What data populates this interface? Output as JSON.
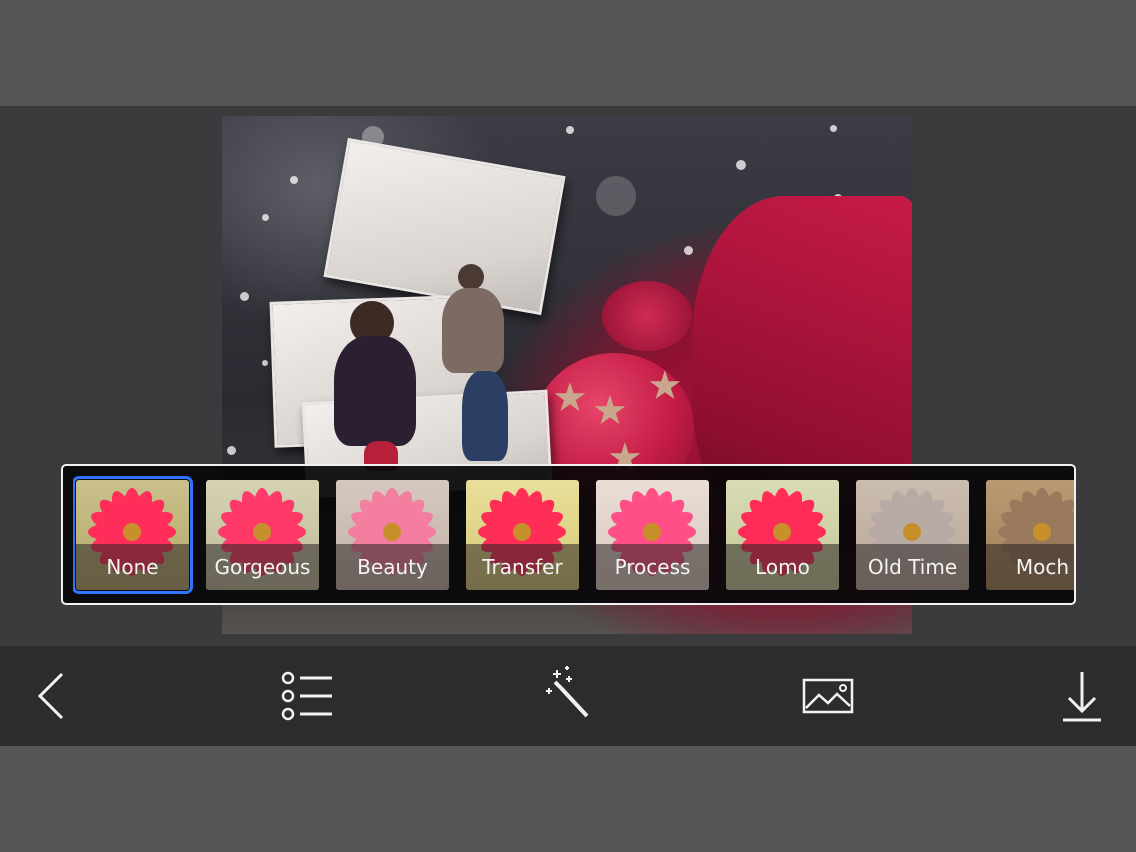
{
  "filters": {
    "selected": "None",
    "items": [
      {
        "label": "None"
      },
      {
        "label": "Gorgeous"
      },
      {
        "label": "Beauty"
      },
      {
        "label": "Transfer"
      },
      {
        "label": "Process"
      },
      {
        "label": "Lomo"
      },
      {
        "label": "Old Time"
      },
      {
        "label": "Moch"
      }
    ]
  },
  "toolbar": {
    "icons": [
      "back-chevron-icon",
      "list-icon",
      "magic-wand-icon",
      "image-icon",
      "download-icon"
    ]
  },
  "colors": {
    "selection": "#2f74ff",
    "toolbar_bg": "#2c2c2e",
    "frame_bg": "#575558"
  }
}
